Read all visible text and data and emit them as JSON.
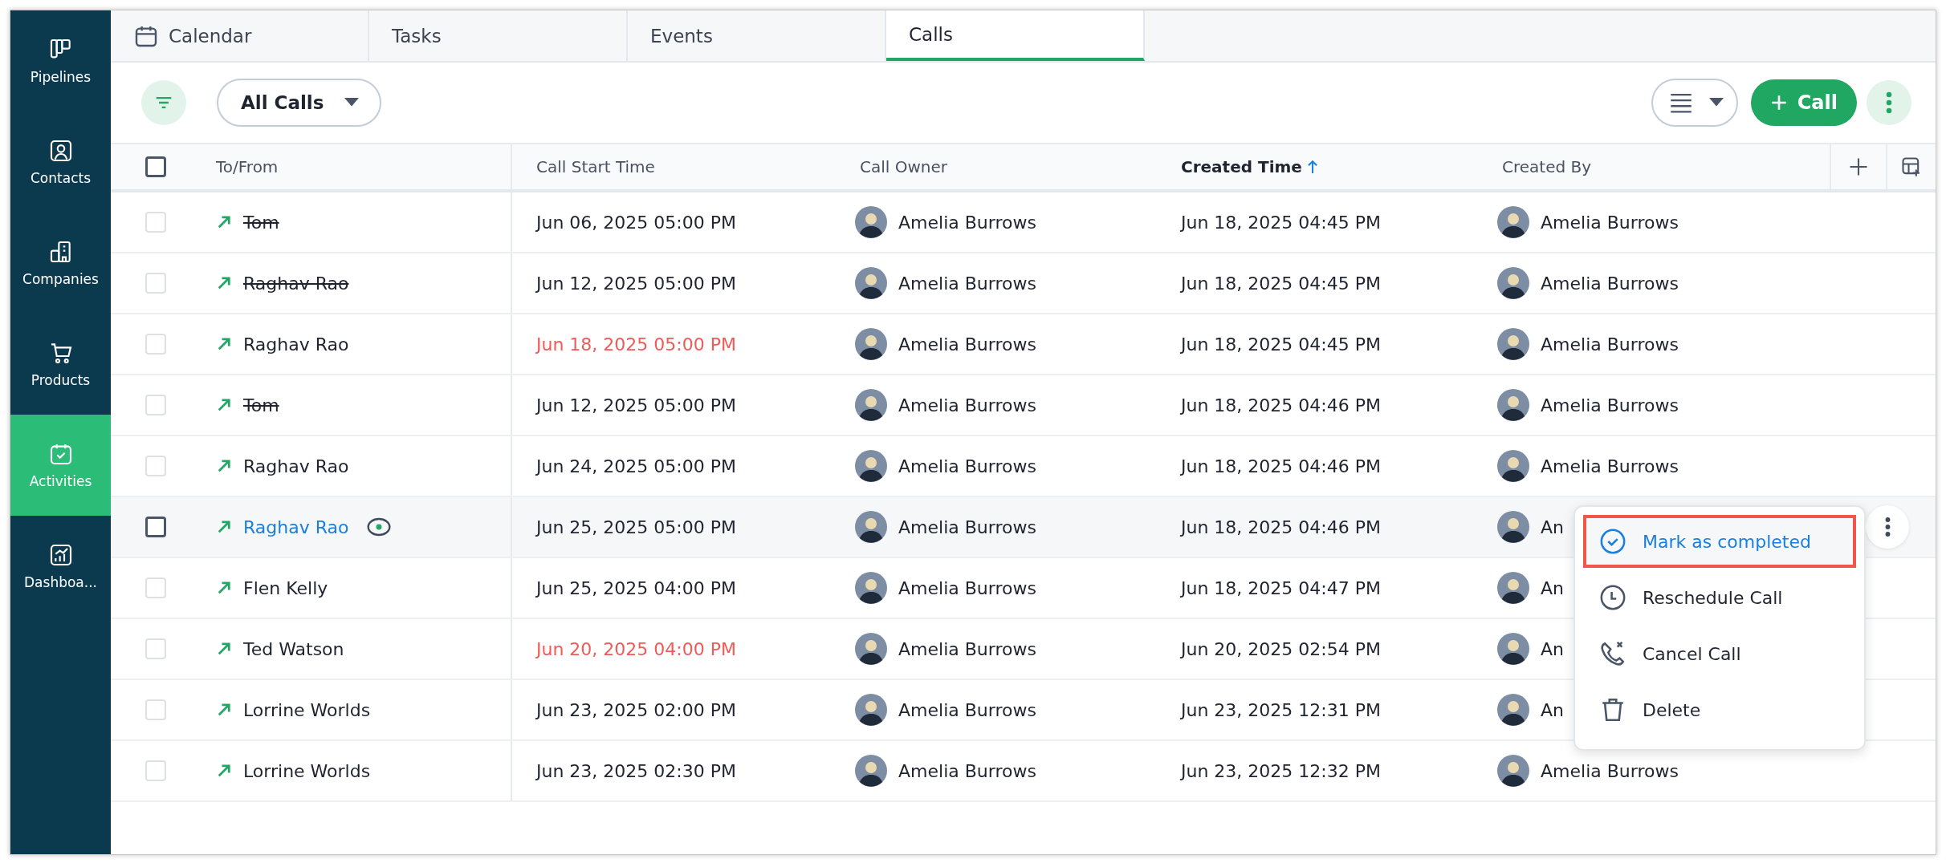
{
  "sidebar": {
    "items": [
      {
        "label": "Pipelines",
        "selected": false
      },
      {
        "label": "Contacts",
        "selected": false
      },
      {
        "label": "Companies",
        "selected": false
      },
      {
        "label": "Products",
        "selected": false
      },
      {
        "label": "Activities",
        "selected": true
      },
      {
        "label": "Dashboa...",
        "selected": false
      }
    ]
  },
  "tabs": [
    {
      "label": "Calendar",
      "selected": false
    },
    {
      "label": "Tasks",
      "selected": false
    },
    {
      "label": "Events",
      "selected": false
    },
    {
      "label": "Calls",
      "selected": true
    }
  ],
  "toolbar": {
    "view": "All Calls",
    "new_button": "Call"
  },
  "table": {
    "select_all_checked": false,
    "columns": [
      {
        "label": "To/From",
        "sorted": false
      },
      {
        "label": "Call Start Time",
        "sorted": false
      },
      {
        "label": "Call Owner",
        "sorted": false
      },
      {
        "label": "Created Time",
        "sorted": true
      },
      {
        "label": "Created By",
        "sorted": false
      }
    ],
    "rows": [
      {
        "to_from": "Tom",
        "completed": true,
        "hovered": false,
        "start": "Jun 06, 2025 05:00 PM",
        "overdue": false,
        "owner": "Amelia Burrows",
        "created": "Jun 18, 2025 04:45 PM",
        "created_by": "Amelia Burrows"
      },
      {
        "to_from": "Raghav Rao",
        "completed": true,
        "hovered": false,
        "start": "Jun 12, 2025 05:00 PM",
        "overdue": false,
        "owner": "Amelia Burrows",
        "created": "Jun 18, 2025 04:45 PM",
        "created_by": "Amelia Burrows"
      },
      {
        "to_from": "Raghav Rao",
        "completed": false,
        "hovered": false,
        "start": "Jun 18, 2025 05:00 PM",
        "overdue": true,
        "owner": "Amelia Burrows",
        "created": "Jun 18, 2025 04:45 PM",
        "created_by": "Amelia Burrows"
      },
      {
        "to_from": "Tom",
        "completed": true,
        "hovered": false,
        "start": "Jun 12, 2025 05:00 PM",
        "overdue": false,
        "owner": "Amelia Burrows",
        "created": "Jun 18, 2025 04:46 PM",
        "created_by": "Amelia Burrows"
      },
      {
        "to_from": "Raghav Rao",
        "completed": false,
        "hovered": false,
        "start": "Jun 24, 2025 05:00 PM",
        "overdue": false,
        "owner": "Amelia Burrows",
        "created": "Jun 18, 2025 04:46 PM",
        "created_by": "Amelia Burrows"
      },
      {
        "to_from": "Raghav Rao",
        "completed": false,
        "hovered": true,
        "start": "Jun 25, 2025 05:00 PM",
        "overdue": false,
        "owner": "Amelia Burrows",
        "created": "Jun 18, 2025 04:46 PM",
        "created_by": "An"
      },
      {
        "to_from": "Flen Kelly",
        "completed": false,
        "hovered": false,
        "start": "Jun 25, 2025 04:00 PM",
        "overdue": false,
        "owner": "Amelia Burrows",
        "created": "Jun 18, 2025 04:47 PM",
        "created_by": "An"
      },
      {
        "to_from": "Ted Watson",
        "completed": false,
        "hovered": false,
        "start": "Jun 20, 2025 04:00 PM",
        "overdue": true,
        "owner": "Amelia Burrows",
        "created": "Jun 20, 2025 02:54 PM",
        "created_by": "An"
      },
      {
        "to_from": "Lorrine Worlds",
        "completed": false,
        "hovered": false,
        "start": "Jun 23, 2025 02:00 PM",
        "overdue": false,
        "owner": "Amelia Burrows",
        "created": "Jun 23, 2025 12:31 PM",
        "created_by": "An"
      },
      {
        "to_from": "Lorrine Worlds",
        "completed": false,
        "hovered": false,
        "start": "Jun 23, 2025 02:30 PM",
        "overdue": false,
        "owner": "Amelia Burrows",
        "created": "Jun 23, 2025 12:32 PM",
        "created_by": "Amelia Burrows"
      }
    ]
  },
  "row_menu": {
    "items": [
      {
        "label": "Mark as completed",
        "kind": "complete",
        "highlighted": true
      },
      {
        "label": "Reschedule Call",
        "kind": "reschedule",
        "highlighted": false
      },
      {
        "label": "Cancel Call",
        "kind": "cancel",
        "highlighted": false
      },
      {
        "label": "Delete",
        "kind": "delete",
        "highlighted": false
      }
    ]
  }
}
